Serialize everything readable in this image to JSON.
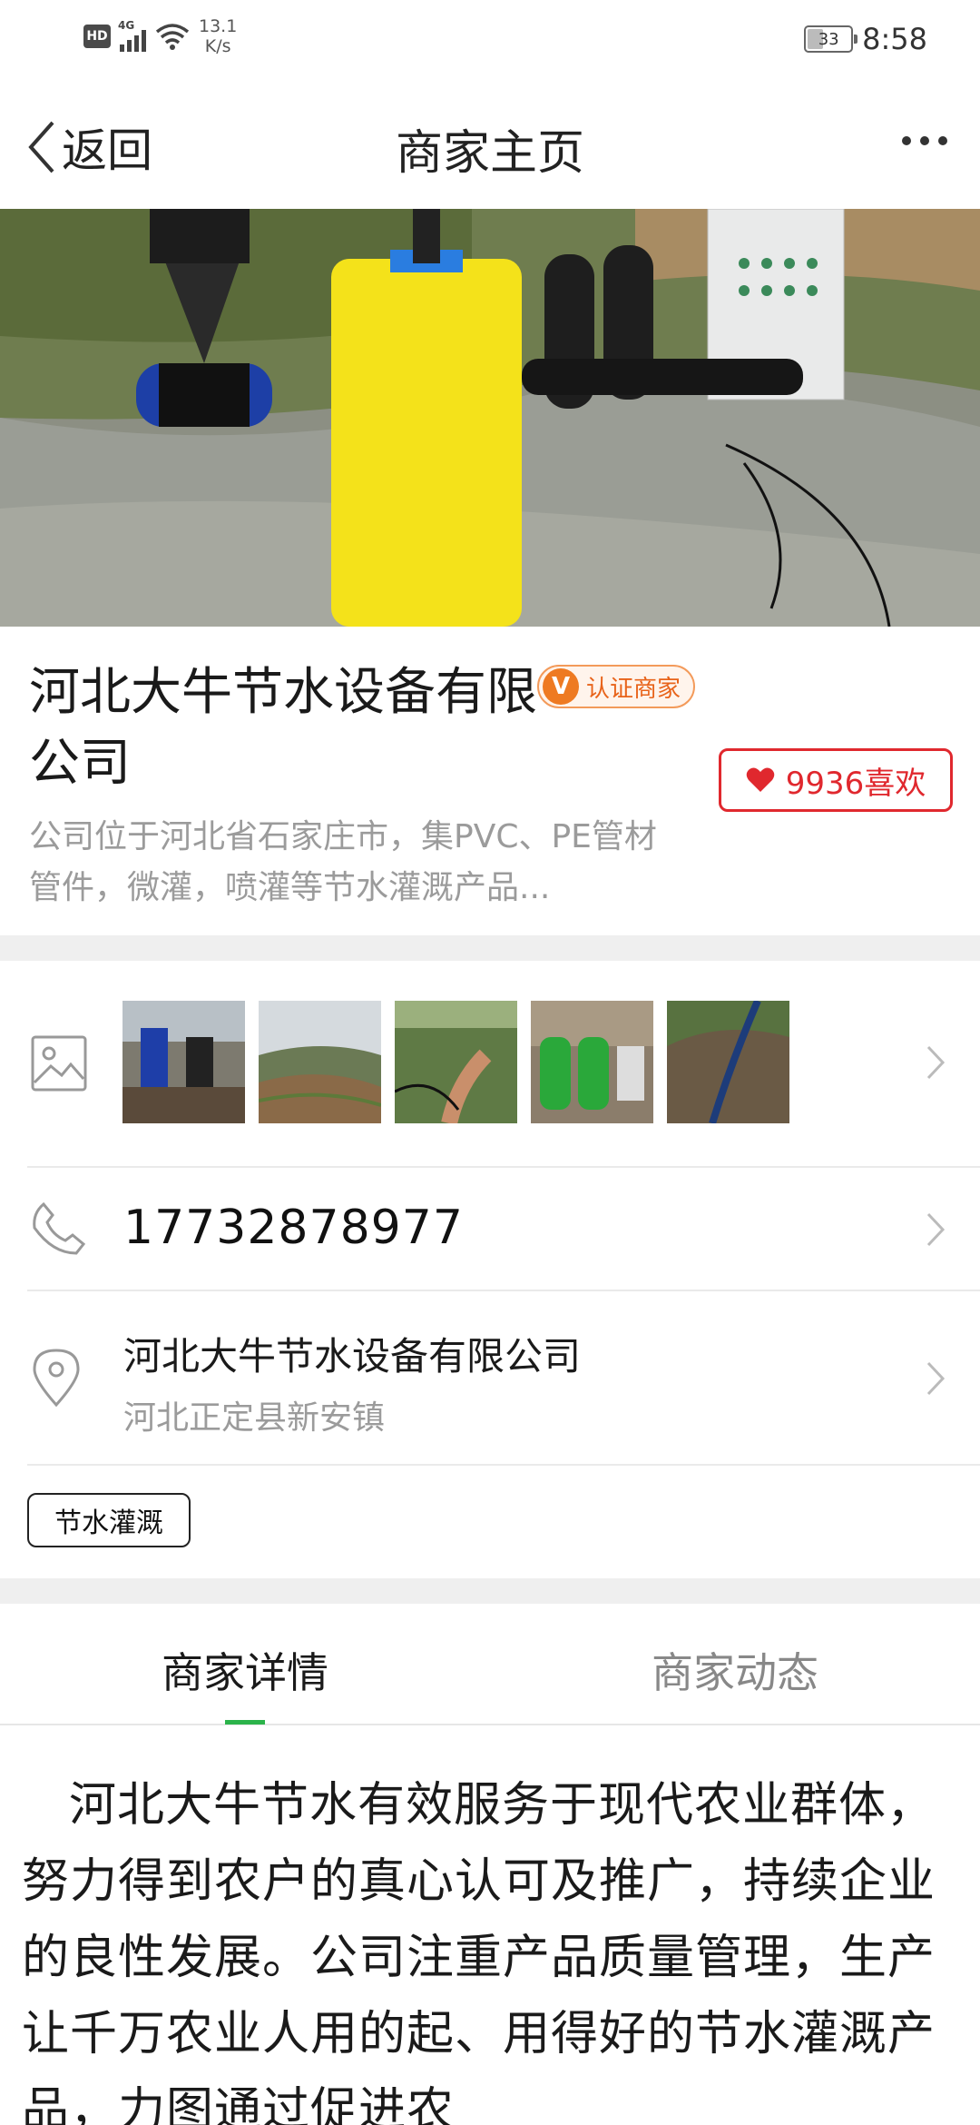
{
  "status_bar": {
    "network": "4G",
    "hd": "HD",
    "speed": "13.1\nK/s",
    "speed_value": "13.1",
    "speed_unit": "K/s",
    "battery": "33",
    "time": "8:58"
  },
  "nav": {
    "back_label": "返回",
    "title": "商家主页"
  },
  "company": {
    "name": "河北大牛节水设备有限公司",
    "verified_badge": "认证商家",
    "verified_letter": "V",
    "likes": "9936喜欢",
    "description": "公司位于河北省石家庄市，集PVC、PE管材管件，微灌，喷灌等节水灌溉产品..."
  },
  "gallery": {
    "thumbnail_count": 5
  },
  "contact": {
    "phone": "17732878977",
    "address_name": "河北大牛节水设备有限公司",
    "address_detail": "河北正定县新安镇"
  },
  "tags": [
    "节水灌溉"
  ],
  "tabs": [
    {
      "label": "商家详情",
      "active": true
    },
    {
      "label": "商家动态",
      "active": false
    }
  ],
  "article": {
    "text": "河北大牛节水有效服务于现代农业群体，努力得到农户的真心认可及推广，持续企业的良性发展。公司注重产品质量管理，生产让千万农业人用的起、用得好的节水灌溉产品，力图通过促进农"
  },
  "colors": {
    "accent_green": "#2bb34a",
    "like_red": "#e0282e",
    "verify_orange": "#ee7a22",
    "muted_text": "#9b9b9b"
  }
}
